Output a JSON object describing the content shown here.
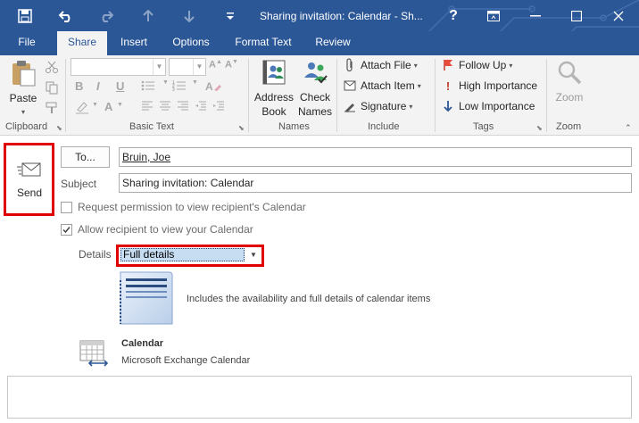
{
  "window": {
    "title": "Sharing invitation: Calendar - Sh...",
    "help": "?",
    "minimize": "—",
    "maximize": "☐",
    "close": "✕",
    "ribbon_display": "⧉"
  },
  "quick_access": [
    {
      "name": "save-icon",
      "glyph": "💾"
    },
    {
      "name": "undo-icon",
      "glyph": "↶"
    },
    {
      "name": "redo-icon",
      "glyph": "↷"
    },
    {
      "name": "up-arrow-icon",
      "glyph": "↑"
    },
    {
      "name": "down-arrow-icon",
      "glyph": "↓"
    },
    {
      "name": "customize-icon",
      "glyph": "▾"
    }
  ],
  "tabs": [
    "File",
    "Share",
    "Insert",
    "Options",
    "Format Text",
    "Review"
  ],
  "active_tab": "Share",
  "ribbon": {
    "clipboard": {
      "paste": "Paste",
      "label": "Clipboard"
    },
    "basic_text": {
      "label": "Basic Text",
      "bold": "B",
      "italic": "I",
      "underline": "U"
    },
    "names": {
      "address_book": [
        "Address",
        "Book"
      ],
      "check_names": [
        "Check",
        "Names"
      ],
      "label": "Names"
    },
    "include": {
      "attach_file": "Attach File",
      "attach_item": "Attach Item",
      "signature": "Signature",
      "label": "Include"
    },
    "tags": {
      "follow_up": "Follow Up",
      "high_importance": "High Importance",
      "low_importance": "Low Importance",
      "label": "Tags"
    },
    "zoom": {
      "zoom": "Zoom",
      "label": "Zoom"
    }
  },
  "form": {
    "send": "Send",
    "to_button": "To...",
    "to_value": "Bruin, Joe",
    "subject_label": "Subject",
    "subject_value": "Sharing invitation: Calendar",
    "request_permission": "Request permission to view recipient's Calendar",
    "request_permission_checked": false,
    "allow_view": "Allow recipient to view your Calendar",
    "allow_view_checked": true,
    "details_label": "Details",
    "details_value": "Full details",
    "details_description": "Includes the availability and full details of calendar items",
    "calendar_name": "Calendar",
    "calendar_type": "Microsoft Exchange Calendar"
  },
  "colors": {
    "accent": "#2b5797",
    "highlight": "#e00000",
    "selection": "#c7ddf2"
  }
}
